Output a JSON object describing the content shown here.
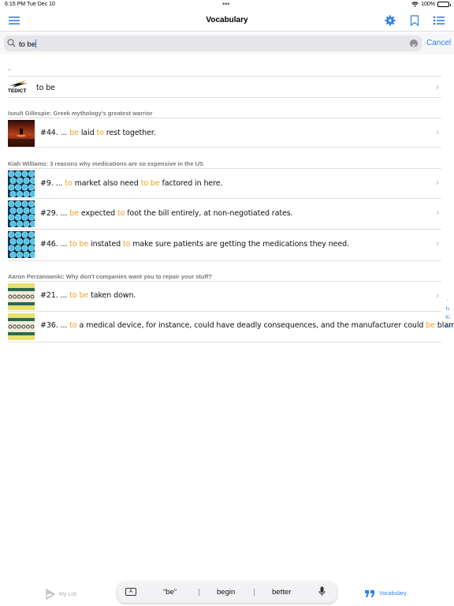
{
  "status": {
    "time": "6:15 PM",
    "date": "Tue Dec 10",
    "battery": "100%"
  },
  "nav": {
    "title": "Vocabulary"
  },
  "search": {
    "value": "to be",
    "cancel": "Cancel"
  },
  "dash": "–",
  "dictionary_row": {
    "logo": "TEDICT",
    "text": "to be"
  },
  "sections": [
    {
      "header": "Iseult Gillespie: Greek mythology's greatest warrior",
      "rows": [
        {
          "segments": [
            {
              "t": "#44. ... ",
              "h": false
            },
            {
              "t": "be",
              "h": true
            },
            {
              "t": " laid ",
              "h": false
            },
            {
              "t": "to",
              "h": true
            },
            {
              "t": " rest together.",
              "h": false
            }
          ]
        }
      ]
    },
    {
      "header": "Kiah Williams: 3 reasons why medications are so expensive in the US",
      "rows": [
        {
          "segments": [
            {
              "t": "#9. ... ",
              "h": false
            },
            {
              "t": "to",
              "h": true
            },
            {
              "t": " market also need ",
              "h": false
            },
            {
              "t": "to be",
              "h": true
            },
            {
              "t": " factored in here.",
              "h": false
            }
          ]
        },
        {
          "segments": [
            {
              "t": "#29. ... ",
              "h": false
            },
            {
              "t": "be",
              "h": true
            },
            {
              "t": " expected ",
              "h": false
            },
            {
              "t": "to",
              "h": true
            },
            {
              "t": " foot the bill entirely, at non-negotiated rates.",
              "h": false
            }
          ]
        },
        {
          "segments": [
            {
              "t": "#46. ... ",
              "h": false
            },
            {
              "t": "to be",
              "h": true
            },
            {
              "t": " instated ",
              "h": false
            },
            {
              "t": "to",
              "h": true
            },
            {
              "t": " make sure patients are getting the medications they need.",
              "h": false
            }
          ]
        }
      ]
    },
    {
      "header": "Aaron Perzanowski: Why don't companies want you to repair your stuff?",
      "rows": [
        {
          "segments": [
            {
              "t": "#21. ... ",
              "h": false
            },
            {
              "t": "to be",
              "h": true
            },
            {
              "t": " taken down.",
              "h": false
            }
          ]
        },
        {
          "segments": [
            {
              "t": "#36. ... ",
              "h": false
            },
            {
              "t": "to",
              "h": true
            },
            {
              "t": " a medical device, for instance, could have deadly consequences, and the manufacturer could ",
              "h": false
            },
            {
              "t": "be",
              "h": true
            },
            {
              "t": " blamed.",
              "h": false
            }
          ]
        }
      ]
    }
  ],
  "index": [
    "-",
    "Is",
    "Ki",
    "Aa"
  ],
  "tabs": {
    "my_list": "My List",
    "vocabulary": "Vocabulary"
  },
  "keyboard": {
    "icon": "A",
    "suggestions": [
      "“be”",
      "begin",
      "better"
    ]
  },
  "colors": {
    "accent": "#2f80ed",
    "highlight": "#f0a020"
  }
}
